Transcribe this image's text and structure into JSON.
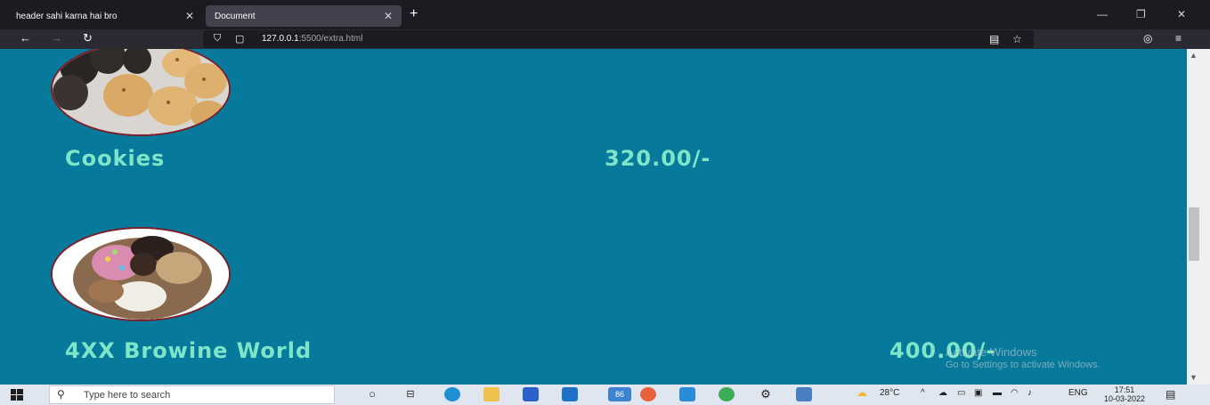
{
  "browser": {
    "tabs": [
      {
        "label": "header sahi karna hai bro",
        "active": false
      },
      {
        "label": "Document",
        "active": true
      }
    ],
    "url_host": "127.0.0.1",
    "url_path": ":5500/extra.html",
    "icons": {
      "back": "←",
      "forward": "→",
      "reload": "↻",
      "shield": "⛉",
      "page": "▢",
      "reader": "▤",
      "bookmark": "☆",
      "pocket": "◎",
      "menu": "≡",
      "close": "✕",
      "new_tab": "+",
      "minimize": "—",
      "maximize": "❐"
    }
  },
  "products": [
    {
      "name": "Cookies",
      "price": "320.00/-"
    },
    {
      "name": "4XX Browine World",
      "price": "400.00/-"
    }
  ],
  "watermark": {
    "line1": "Activate Windows",
    "line2": "Go to Settings to activate Windows."
  },
  "taskbar": {
    "search_placeholder": "Type here to search",
    "badge": "86",
    "weather": "28°C",
    "language": "ENG",
    "time": "17:51",
    "date": "10-03-2022"
  },
  "colors": {
    "page_bg": "#07799b",
    "text": "#7de6c8",
    "image_border": "#7a1f2b"
  }
}
